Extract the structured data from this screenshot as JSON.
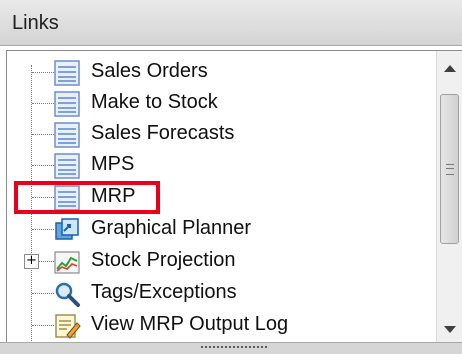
{
  "panel": {
    "title": "Links"
  },
  "tree": {
    "items": [
      {
        "label": "Sales Orders",
        "icon": "document-list-icon",
        "expandable": false
      },
      {
        "label": "Make to Stock",
        "icon": "document-list-icon",
        "expandable": false
      },
      {
        "label": "Sales Forecasts",
        "icon": "document-list-icon",
        "expandable": false
      },
      {
        "label": "MPS",
        "icon": "document-list-icon",
        "expandable": false
      },
      {
        "label": "MRP",
        "icon": "document-list-icon",
        "expandable": false,
        "highlighted": true
      },
      {
        "label": "Graphical Planner",
        "icon": "graphical-planner-icon",
        "expandable": false
      },
      {
        "label": "Stock Projection",
        "icon": "chart-icon",
        "expandable": true,
        "expander": "+"
      },
      {
        "label": "Tags/Exceptions",
        "icon": "magnifier-icon",
        "expandable": false
      },
      {
        "label": "View MRP Output Log",
        "icon": "log-edit-icon",
        "expandable": false
      }
    ]
  },
  "colors": {
    "highlight": "#e8001b",
    "header_bg": "#dcdcdc"
  }
}
